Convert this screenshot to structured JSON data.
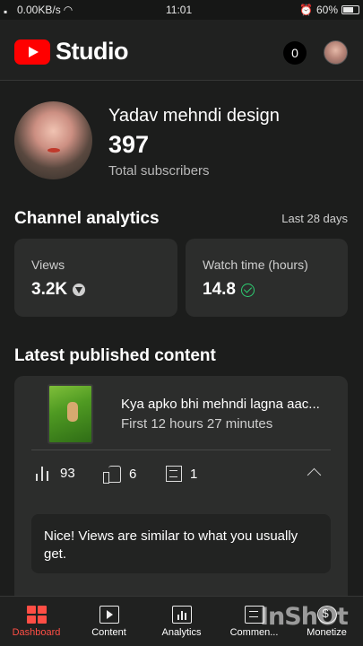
{
  "status_bar": {
    "network_speed": "0.00KB/s",
    "time": "11:01",
    "battery": "60%"
  },
  "header": {
    "logo_text": "Studio",
    "notification_count": "0",
    "brand_color": "#ff0000"
  },
  "channel": {
    "name": "Yadav mehndi design",
    "subscribers": "397",
    "subscribers_label": "Total subscribers"
  },
  "analytics": {
    "title": "Channel analytics",
    "period": "Last 28 days",
    "cards": [
      {
        "label": "Views",
        "value": "3.2K",
        "indicator": "down-arrow-icon"
      },
      {
        "label": "Watch time (hours)",
        "value": "14.8",
        "indicator": "check-icon"
      }
    ]
  },
  "latest": {
    "title": "Latest published content",
    "video": {
      "title": "Kya apko bhi mehndi lagna aac...",
      "period": "First 12 hours 27 minutes",
      "views": "93",
      "likes": "6",
      "comments": "1"
    },
    "insight": "Nice! Views are similar to what you usually get."
  },
  "bottom_nav": {
    "items": [
      {
        "label": "Dashboard",
        "icon": "dashboard-icon",
        "active": true
      },
      {
        "label": "Content",
        "icon": "content-icon",
        "active": false
      },
      {
        "label": "Analytics",
        "icon": "analytics-icon",
        "active": false
      },
      {
        "label": "Commen...",
        "icon": "comments-icon",
        "active": false
      },
      {
        "label": "Monetize",
        "icon": "monetize-icon",
        "active": false
      }
    ],
    "active_color": "#ff4e45"
  },
  "watermark": "InShOt"
}
